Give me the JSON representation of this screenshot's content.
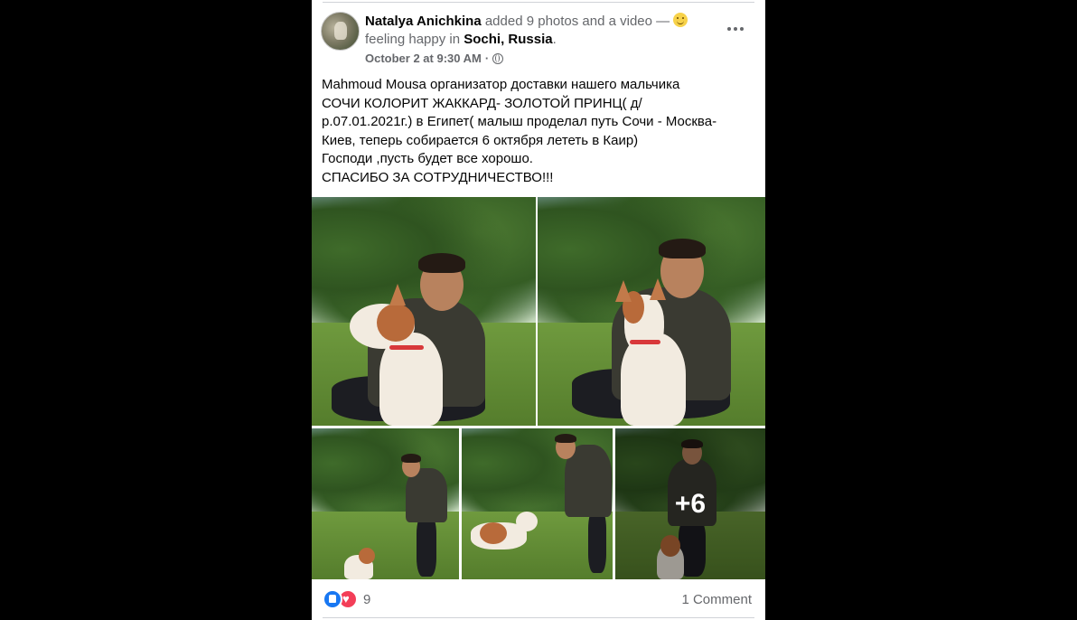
{
  "post": {
    "author": "Natalya Anichkina",
    "action_text": " added 9 photos and a video — ",
    "feeling_text": " feeling happy in ",
    "location": "Sochi, Russia",
    "location_suffix": ".",
    "timestamp": "October 2 at 9:30 AM",
    "timestamp_sep": " · ",
    "privacy_icon": "globe-icon",
    "more_icon": "more-options-icon",
    "body": "Mahmoud Mousa организатор доставки нашего мальчика\nСОЧИ КОЛОРИТ ЖАККАРД- ЗОЛОТОЙ ПРИНЦ(  д/\nр.07.01.2021г.) в Египет( малыш проделал путь Сочи - Москва-\nКиев, теперь собирается 6 октября  лететь в Каир)\nГосподи ,пусть будет все хорошо.\nСПАСИБО ЗА СОТРУДНИЧЕСТВО!!!",
    "more_photos_label": "+6",
    "reaction_icons": [
      "like-icon",
      "love-icon"
    ],
    "reaction_count": "9",
    "comments_label": "1 Comment"
  },
  "colors": {
    "background": "#000000",
    "card": "#ffffff",
    "secondary_text": "#65676b",
    "primary_text": "#050505",
    "like_blue": "#1877f2",
    "love_red": "#f33e58"
  }
}
